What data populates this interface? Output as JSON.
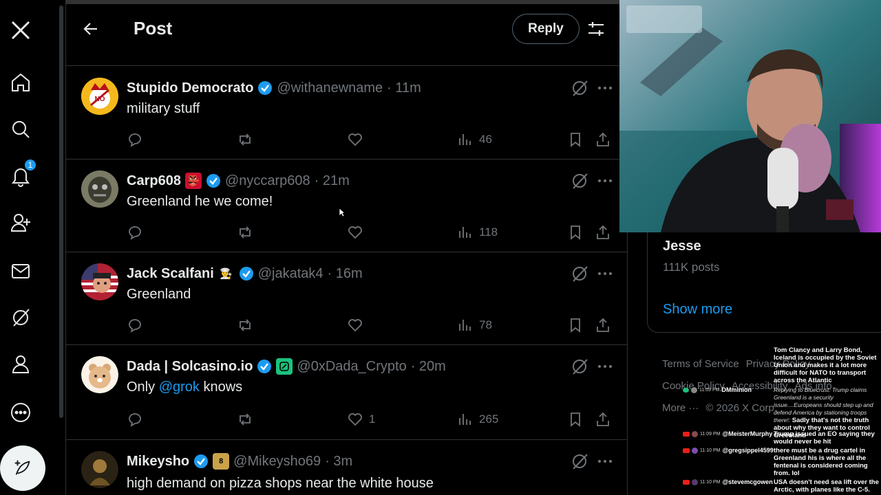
{
  "nav": {
    "notifications_badge": "1",
    "items": [
      "x-logo-icon",
      "home-icon",
      "search-icon",
      "notifications-icon",
      "communities-icon",
      "messages-icon",
      "grok-icon",
      "profile-icon",
      "more-icon",
      "post-compose-icon"
    ]
  },
  "header": {
    "title": "Post",
    "reply_label": "Reply"
  },
  "replies": [
    {
      "display_name": "Stupido Democrato",
      "handle": "@withanewname",
      "time": "· 11m",
      "text": "military stuff",
      "likes": "",
      "views": "46"
    },
    {
      "display_name": "Carp608",
      "handle": "@nyccarp608",
      "time": "· 21m",
      "text": "Greenland he we come!",
      "likes": "",
      "views": "118"
    },
    {
      "display_name": "Jack Scalfani",
      "handle": "@jakatak4",
      "time": "· 16m",
      "text": "Greenland",
      "likes": "",
      "views": "78"
    },
    {
      "display_name": "Dada | Solcasino.io",
      "handle": "@0xDada_Crypto",
      "time": "· 20m",
      "text_before": "Only ",
      "mention": "@grok",
      "text_after": " knows",
      "likes": "1",
      "views": "265"
    },
    {
      "display_name": "Mikeysho",
      "handle": "@Mikeysho69",
      "time": "· 3m",
      "text": "high demand on pizza shops near the white house"
    }
  ],
  "sidebar": {
    "trend_name": "Jesse",
    "trend_posts": "111K posts",
    "show_more": "Show more",
    "footer": [
      "Terms of Service",
      "Privacy Policy",
      "Cookie Policy",
      "Accessibility",
      "Ads info",
      "More ···",
      "© 2026 X Corp."
    ]
  },
  "chat": [
    {
      "time": "",
      "user": "",
      "text": "Tom Clancy and Larry Bond, Iceland is occupied by the Soviet Union and makes it a lot more difficult for NATO to transport across the Atlantic"
    },
    {
      "time": "11:09 PM",
      "user": "DMminion",
      "reply": "Replying to Bluecrust: Trump claims Greenland is a security issue....Europeans should step up and defend America by stationing troops there!:",
      "text": "Sadly that's not the truth about why they want to control Greenland"
    },
    {
      "time": "11:09 PM",
      "user": "@MeisterMurphy",
      "text": "Trump issued an EO saying they would never be hit"
    },
    {
      "time": "11:10 PM",
      "user": "@gregsippel4599",
      "text": "there must be a drug cartel in Greenland his is where all the fentenal is considered coming from. lol"
    },
    {
      "time": "11:10 PM",
      "user": "@stevemcgowen",
      "text": "USA doesn't need sea lift over the Arctic, with planes like the C-5."
    }
  ],
  "colors": {
    "background": "#000000",
    "accent": "#1d9bf0",
    "secondary_text": "#71767b",
    "border": "#2f3336"
  }
}
